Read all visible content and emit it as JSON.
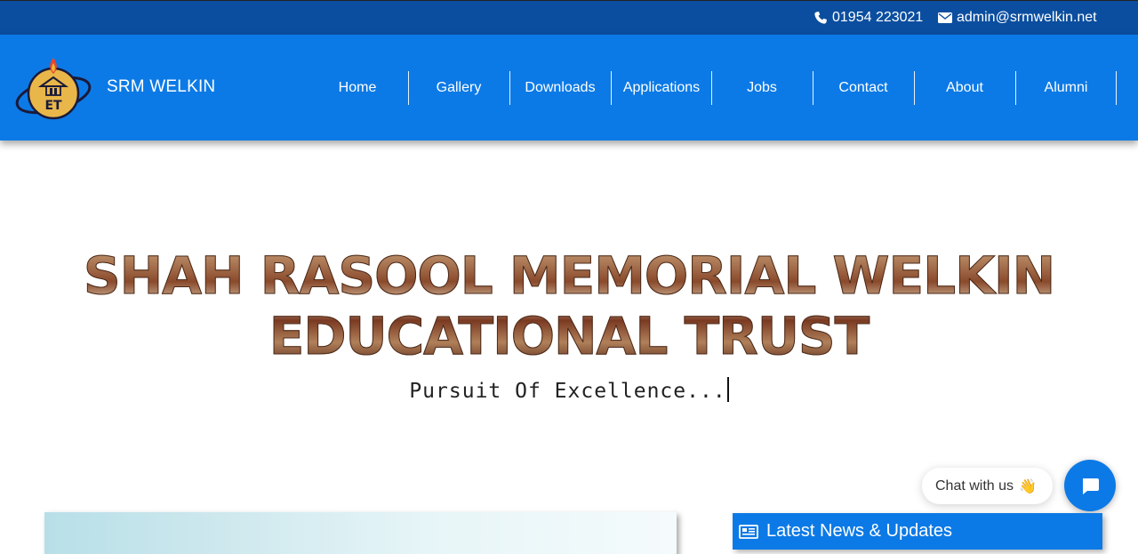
{
  "topbar": {
    "phone": "01954 223021",
    "email": "admin@srmwelkin.net",
    "phone_icon": "phone-icon",
    "email_icon": "envelope-icon"
  },
  "navbar": {
    "brand": "SRM WELKIN",
    "logo_text": "ET",
    "items": [
      {
        "label": "Home"
      },
      {
        "label": "Gallery"
      },
      {
        "label": "Downloads"
      },
      {
        "label": "Applications"
      },
      {
        "label": "Jobs"
      },
      {
        "label": "Contact"
      },
      {
        "label": "About"
      },
      {
        "label": "Alumni"
      }
    ]
  },
  "hero": {
    "title_line1": "SHAH RASOOL MEMORIAL WELKIN",
    "title_line2": "EDUCATIONAL TRUST",
    "tagline": "Pursuit Of Excellence..."
  },
  "chat": {
    "label": "Chat with us",
    "emoji": "👋",
    "button_icon": "chat-bubble-icon"
  },
  "news": {
    "title": "Latest News & Updates",
    "icon": "newspaper-icon"
  },
  "colors": {
    "topbar_bg": "#0b4e9f",
    "nav_bg": "#0c7ae6",
    "accent": "#0c7ae6"
  }
}
